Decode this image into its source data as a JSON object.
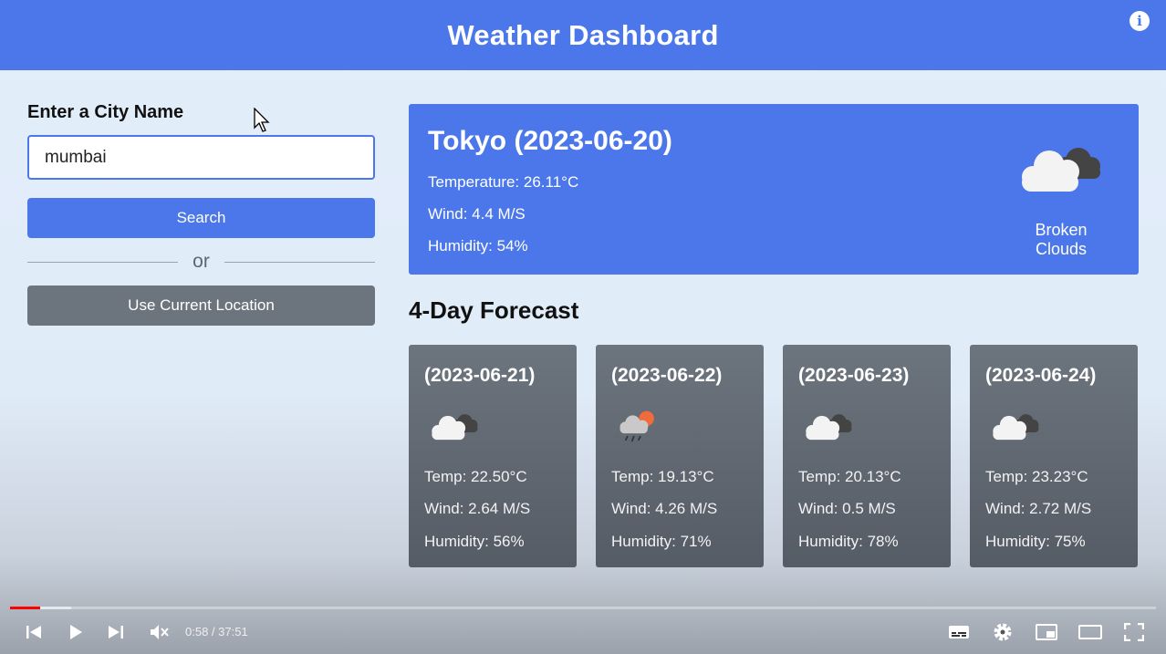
{
  "header": {
    "title": "Weather Dashboard"
  },
  "sidebar": {
    "label": "Enter a City Name",
    "input_value": "mumbai",
    "search_label": "Search",
    "or_label": "or",
    "location_label": "Use Current Location"
  },
  "current": {
    "title": "Tokyo (2023-06-20)",
    "temperature": "Temperature: 26.11°C",
    "wind": "Wind: 4.4 M/S",
    "humidity": "Humidity: 54%",
    "description": "Broken Clouds",
    "icon": "broken-clouds-icon"
  },
  "forecast": {
    "title": "4-Day Forecast",
    "days": [
      {
        "date": "(2023-06-21)",
        "icon": "broken-clouds-icon",
        "temp": "Temp: 22.50°C",
        "wind": "Wind: 2.64 M/S",
        "humidity": "Humidity: 56%"
      },
      {
        "date": "(2023-06-22)",
        "icon": "rain-sun-icon",
        "temp": "Temp: 19.13°C",
        "wind": "Wind: 4.26 M/S",
        "humidity": "Humidity: 71%"
      },
      {
        "date": "(2023-06-23)",
        "icon": "broken-clouds-icon",
        "temp": "Temp: 20.13°C",
        "wind": "Wind: 0.5 M/S",
        "humidity": "Humidity: 78%"
      },
      {
        "date": "(2023-06-24)",
        "icon": "broken-clouds-icon",
        "temp": "Temp: 23.23°C",
        "wind": "Wind: 2.72 M/S",
        "humidity": "Humidity: 75%"
      }
    ]
  },
  "player": {
    "time": "0:58 / 37:51",
    "progress_fraction": 0.026,
    "buffer_fraction": 0.053
  },
  "colors": {
    "accent": "#4b77ea",
    "card": "#606873",
    "secondary_button": "#6c757d"
  }
}
